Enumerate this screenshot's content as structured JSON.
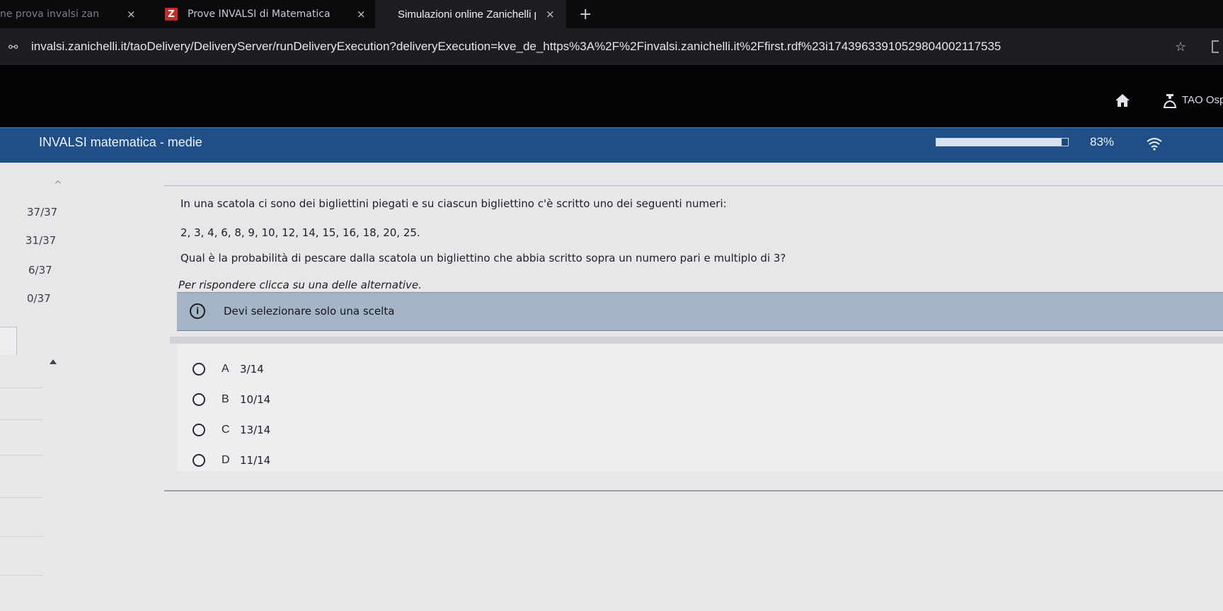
{
  "browser": {
    "tabs": [
      {
        "label": "ne prova invalsi zan",
        "active": false
      },
      {
        "label": "Prove INVALSI di Matematica",
        "favicon": "Z",
        "active": false
      },
      {
        "label": "Simulazioni online Zanichelli p",
        "active": true
      }
    ],
    "close_symbol": "×",
    "new_tab_symbol": "+",
    "url": "invalsi.zanichelli.it/taoDelivery/DeliveryServer/runDeliveryExecution?deliveryExecution=kve_de_https%3A%2F%2Finvalsi.zanichelli.it%2Ffirst.rdf%23i17439633910529804002117535",
    "site_icon": "⚯",
    "star_symbol": "☆"
  },
  "header": {
    "user_name": "TAO Ospi"
  },
  "test": {
    "title": "INVALSI matematica - medie",
    "progress_fraction": 0.95,
    "percent_label": "83%"
  },
  "sidebar": {
    "up_symbol": "^",
    "items": [
      "37/37",
      "31/37",
      "6/37",
      "0/37"
    ]
  },
  "item": {
    "intro": "In una scatola ci sono dei bigliettini piegati e su ciascun bigliettino c'è scritto uno dei seguenti numeri:",
    "numbers": "2, 3, 4, 6, 8, 9, 10, 12, 14, 15, 16, 18, 20, 25.",
    "question": "Qual è la probabilità di pescare dalla scatola un bigliettino che abbia scritto sopra un numero pari e multiplo di 3?",
    "instruction": "Per rispondere clicca su una delle alternative.",
    "info_symbol": "i",
    "info_message": "Devi selezionare solo una scelta",
    "choices": [
      {
        "letter": "A",
        "text": "3/14"
      },
      {
        "letter": "B",
        "text": "10/14"
      },
      {
        "letter": "C",
        "text": "13/14"
      },
      {
        "letter": "D",
        "text": "11/14"
      }
    ]
  },
  "colors": {
    "title_bar": "#1f4f86",
    "info_box": "#a3b5c6",
    "page_background": "#e9e6ea"
  }
}
